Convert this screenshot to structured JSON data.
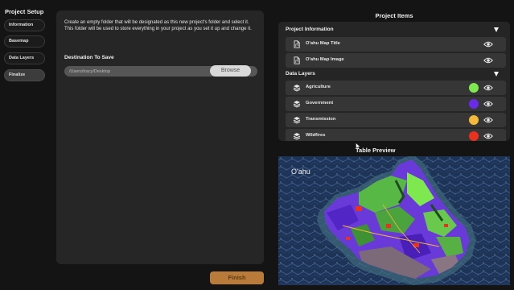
{
  "sidebar": {
    "title": "Project Setup",
    "items": [
      {
        "label": "Information"
      },
      {
        "label": "Basemap"
      },
      {
        "label": "Data Layers"
      },
      {
        "label": "Finalize",
        "active": true
      }
    ]
  },
  "main": {
    "description": "Create an empty folder that will be designated as this new project's folder and select it. This folder will be used to store everything in your project as you set it up and change it.",
    "destination_label": "Destination To Save",
    "path_value": "/Users/tracy/Desktop",
    "browse_label": "Browse",
    "finish_label": "Finish"
  },
  "project_items": {
    "title": "Project Items",
    "project_information": {
      "header": "Project Information",
      "rows": [
        {
          "label": "O'ahu Map Title",
          "icon": "document-icon"
        },
        {
          "label": "O'ahu Map Image",
          "icon": "document-icon"
        }
      ]
    },
    "data_layers": {
      "header": "Data Layers",
      "rows": [
        {
          "label": "Agriculture",
          "icon": "layers-icon",
          "color": "#7ee84f"
        },
        {
          "label": "Government",
          "icon": "layers-icon",
          "color": "#6a2be8"
        },
        {
          "label": "Transmission",
          "icon": "layers-icon",
          "color": "#f2b93b"
        },
        {
          "label": "Wildfires",
          "icon": "layers-icon",
          "color": "#e8321e"
        }
      ]
    }
  },
  "table_preview": {
    "title": "Table Preview",
    "map_label": "O'ahu"
  },
  "colors": {
    "background": "#141414",
    "panel": "#262626",
    "finish_button": "#b87b3a",
    "ocean": "#1f3354"
  }
}
